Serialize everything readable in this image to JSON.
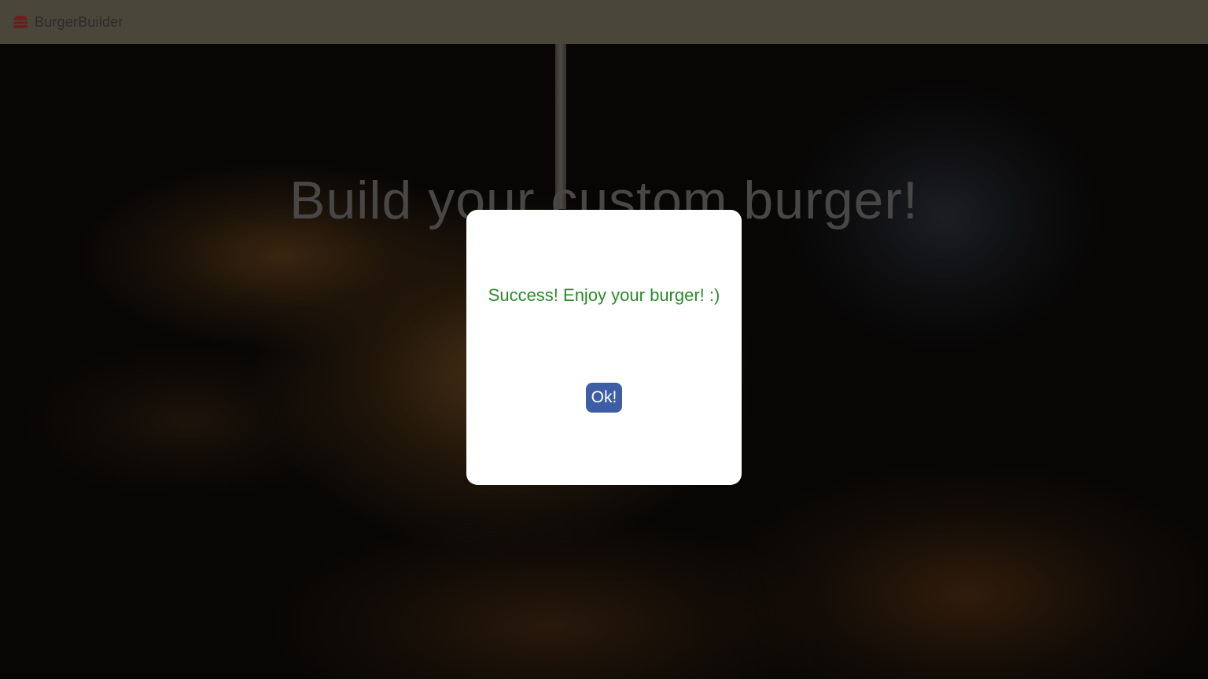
{
  "navbar": {
    "brand_label": "BurgerBuilder",
    "brand_icon": "burger-icon",
    "background_color": "#4a473a"
  },
  "hero": {
    "title": "Build your custom burger!"
  },
  "modal": {
    "message": "Success! Enjoy your burger! :)",
    "message_color": "#2b8a2b",
    "ok_label": "Ok!",
    "ok_button_color": "#3d5da4"
  }
}
